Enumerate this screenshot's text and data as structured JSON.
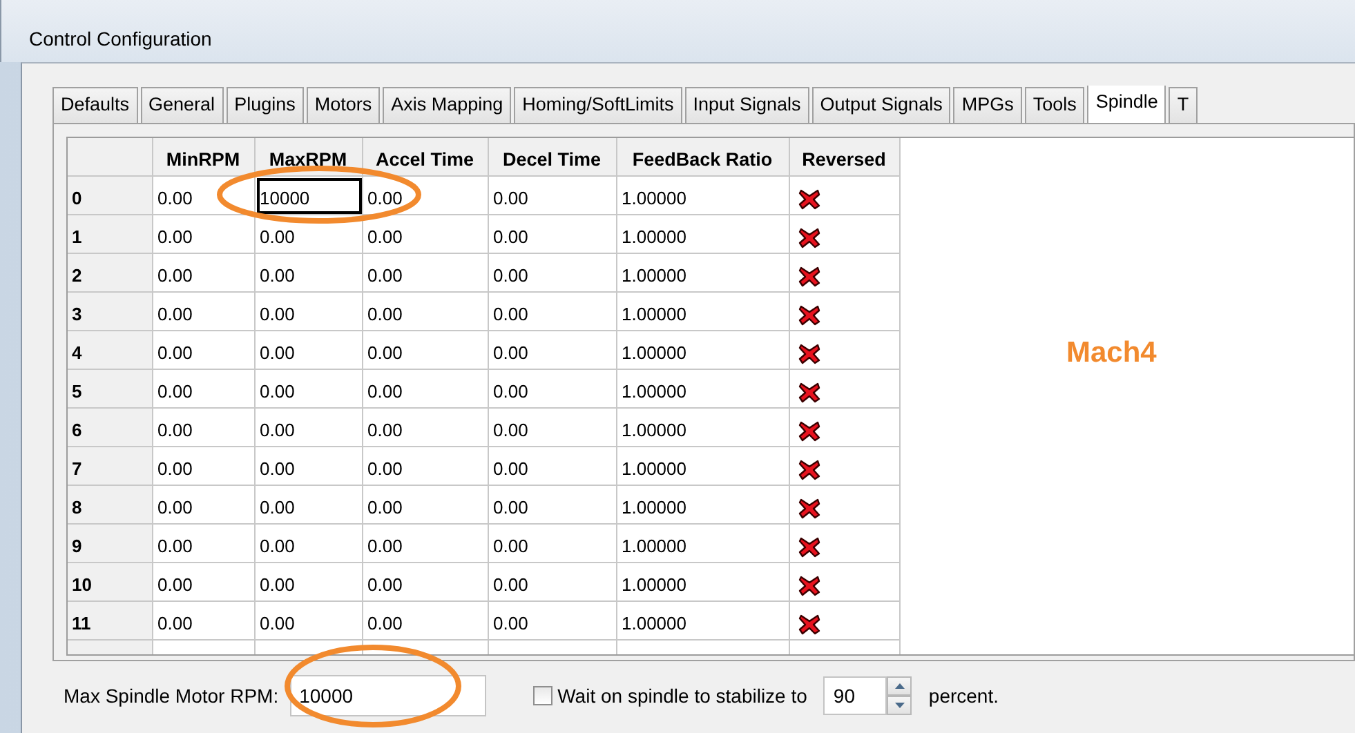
{
  "window": {
    "title": "Control Configuration"
  },
  "tabs": [
    {
      "label": "Defaults",
      "selected": false
    },
    {
      "label": "General",
      "selected": false
    },
    {
      "label": "Plugins",
      "selected": false
    },
    {
      "label": "Motors",
      "selected": false
    },
    {
      "label": "Axis Mapping",
      "selected": false
    },
    {
      "label": "Homing/SoftLimits",
      "selected": false
    },
    {
      "label": "Input Signals",
      "selected": false
    },
    {
      "label": "Output Signals",
      "selected": false
    },
    {
      "label": "MPGs",
      "selected": false
    },
    {
      "label": "Tools",
      "selected": false
    },
    {
      "label": "Spindle",
      "selected": true
    },
    {
      "label": "T",
      "selected": false
    }
  ],
  "table": {
    "columns": [
      "MinRPM",
      "MaxRPM",
      "Accel Time",
      "Decel Time",
      "FeedBack Ratio",
      "Reversed"
    ],
    "rows": [
      {
        "header": "0",
        "cells": [
          {
            "text": "0.00",
            "selected": false
          },
          {
            "text": "10000",
            "selected": true
          },
          {
            "text": "0.00",
            "selected": false
          },
          {
            "text": "0.00",
            "selected": false
          },
          {
            "text": "1.00000",
            "selected": false
          }
        ],
        "reversed": false
      },
      {
        "header": "1",
        "cells": [
          {
            "text": "0.00",
            "selected": false
          },
          {
            "text": "0.00",
            "selected": false
          },
          {
            "text": "0.00",
            "selected": false
          },
          {
            "text": "0.00",
            "selected": false
          },
          {
            "text": "1.00000",
            "selected": false
          }
        ],
        "reversed": false
      },
      {
        "header": "2",
        "cells": [
          {
            "text": "0.00",
            "selected": false
          },
          {
            "text": "0.00",
            "selected": false
          },
          {
            "text": "0.00",
            "selected": false
          },
          {
            "text": "0.00",
            "selected": false
          },
          {
            "text": "1.00000",
            "selected": false
          }
        ],
        "reversed": false
      },
      {
        "header": "3",
        "cells": [
          {
            "text": "0.00",
            "selected": false
          },
          {
            "text": "0.00",
            "selected": false
          },
          {
            "text": "0.00",
            "selected": false
          },
          {
            "text": "0.00",
            "selected": false
          },
          {
            "text": "1.00000",
            "selected": false
          }
        ],
        "reversed": false
      },
      {
        "header": "4",
        "cells": [
          {
            "text": "0.00",
            "selected": false
          },
          {
            "text": "0.00",
            "selected": false
          },
          {
            "text": "0.00",
            "selected": false
          },
          {
            "text": "0.00",
            "selected": false
          },
          {
            "text": "1.00000",
            "selected": false
          }
        ],
        "reversed": false
      },
      {
        "header": "5",
        "cells": [
          {
            "text": "0.00",
            "selected": false
          },
          {
            "text": "0.00",
            "selected": false
          },
          {
            "text": "0.00",
            "selected": false
          },
          {
            "text": "0.00",
            "selected": false
          },
          {
            "text": "1.00000",
            "selected": false
          }
        ],
        "reversed": false
      },
      {
        "header": "6",
        "cells": [
          {
            "text": "0.00",
            "selected": false
          },
          {
            "text": "0.00",
            "selected": false
          },
          {
            "text": "0.00",
            "selected": false
          },
          {
            "text": "0.00",
            "selected": false
          },
          {
            "text": "1.00000",
            "selected": false
          }
        ],
        "reversed": false
      },
      {
        "header": "7",
        "cells": [
          {
            "text": "0.00",
            "selected": false
          },
          {
            "text": "0.00",
            "selected": false
          },
          {
            "text": "0.00",
            "selected": false
          },
          {
            "text": "0.00",
            "selected": false
          },
          {
            "text": "1.00000",
            "selected": false
          }
        ],
        "reversed": false
      },
      {
        "header": "8",
        "cells": [
          {
            "text": "0.00",
            "selected": false
          },
          {
            "text": "0.00",
            "selected": false
          },
          {
            "text": "0.00",
            "selected": false
          },
          {
            "text": "0.00",
            "selected": false
          },
          {
            "text": "1.00000",
            "selected": false
          }
        ],
        "reversed": false
      },
      {
        "header": "9",
        "cells": [
          {
            "text": "0.00",
            "selected": false
          },
          {
            "text": "0.00",
            "selected": false
          },
          {
            "text": "0.00",
            "selected": false
          },
          {
            "text": "0.00",
            "selected": false
          },
          {
            "text": "1.00000",
            "selected": false
          }
        ],
        "reversed": false
      },
      {
        "header": "10",
        "cells": [
          {
            "text": "0.00",
            "selected": false
          },
          {
            "text": "0.00",
            "selected": false
          },
          {
            "text": "0.00",
            "selected": false
          },
          {
            "text": "0.00",
            "selected": false
          },
          {
            "text": "1.00000",
            "selected": false
          }
        ],
        "reversed": false
      },
      {
        "header": "11",
        "cells": [
          {
            "text": "0.00",
            "selected": false
          },
          {
            "text": "0.00",
            "selected": false
          },
          {
            "text": "0.00",
            "selected": false
          },
          {
            "text": "0.00",
            "selected": false
          },
          {
            "text": "1.00000",
            "selected": false
          }
        ],
        "reversed": false
      }
    ]
  },
  "overlay_label": "Mach4",
  "max_rpm": {
    "label": "Max Spindle Motor RPM:",
    "value": "10000"
  },
  "stabilize": {
    "label": "Wait on spindle to stabilize to",
    "checked": false,
    "value": "90",
    "suffix": "percent."
  }
}
